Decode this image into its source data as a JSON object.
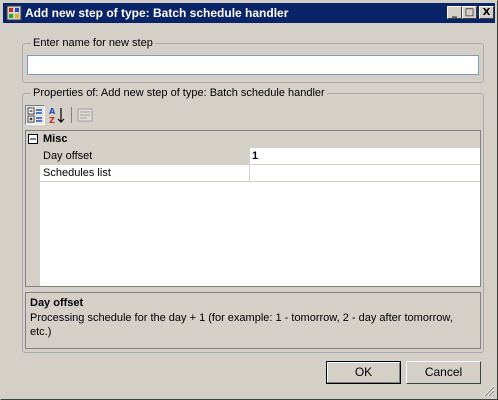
{
  "window": {
    "title": "Add new step of type: Batch schedule handler",
    "controls": {
      "minimize": "_",
      "maximize": "□",
      "close": "X"
    }
  },
  "name_group": {
    "legend": "Enter name for new step",
    "input_value": ""
  },
  "properties_group": {
    "legend": "Properties of: Add new step of type: Batch schedule handler",
    "toolbar": [
      "categorized-icon",
      "alphabetical-sort-icon",
      "property-pages-icon"
    ],
    "grid": {
      "category": {
        "toggle": "⊟",
        "name": "Misc"
      },
      "rows": [
        {
          "label": "Day offset",
          "value": "1"
        },
        {
          "label": "Schedules list",
          "value": ""
        }
      ]
    },
    "help": {
      "title": "Day offset",
      "description": "Processing schedule for the day + 1 (for example: 1 - tomorrow, 2 - day after tomorrow, etc.)"
    }
  },
  "buttons": {
    "ok": "OK",
    "cancel": "Cancel"
  },
  "colors": {
    "title_bar": "#0a246a",
    "dialog_bg": "#d4d0c8"
  }
}
